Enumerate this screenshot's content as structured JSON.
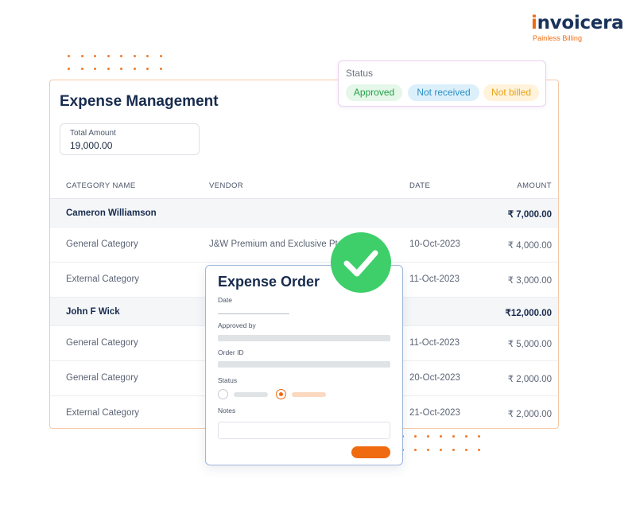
{
  "brand": {
    "name_prefix": "i",
    "name_rest": "nvoicera",
    "tagline": "Painless Billing"
  },
  "colors": {
    "accent": "#f06a0f",
    "brand_navy": "#18325a",
    "success": "#3ecf6a"
  },
  "expense": {
    "title": "Expense Management",
    "total_label": "Total Amount",
    "total_value": "19,000.00",
    "columns": [
      "CATEGORY NAME",
      "VENDOR",
      "DATE",
      "AMOUNT"
    ],
    "groups": [
      {
        "name": "Cameron Williamson",
        "total": "₹ 7,000.00",
        "rows": [
          {
            "category": "General Category",
            "vendor": "J&W Premium and Exclusive Pte",
            "date": "10-Oct-2023",
            "amount": "₹ 4,000.00"
          },
          {
            "category": "External Category",
            "vendor": "",
            "date": "11-Oct-2023",
            "amount": "₹ 3,000.00"
          }
        ]
      },
      {
        "name": "John F Wick",
        "total": "₹12,000.00",
        "rows": [
          {
            "category": "General Category",
            "vendor": "",
            "date": "11-Oct-2023",
            "amount": "₹ 5,000.00"
          },
          {
            "category": "General Category",
            "vendor": "",
            "date": "20-Oct-2023",
            "amount": "₹ 2,000.00"
          },
          {
            "category": "External Category",
            "vendor": "",
            "date": "21-Oct-2023",
            "amount": "₹ 2,000.00"
          }
        ]
      }
    ]
  },
  "status_popup": {
    "title": "Status",
    "badges": [
      "Approved",
      "Not received",
      "Not billed"
    ]
  },
  "order": {
    "title": "Expense Order",
    "date_label": "Date",
    "approved_label": "Approved by",
    "order_id_label": "Order ID",
    "status_label": "Status",
    "notes_label": "Notes",
    "selected_status_option": 2
  }
}
